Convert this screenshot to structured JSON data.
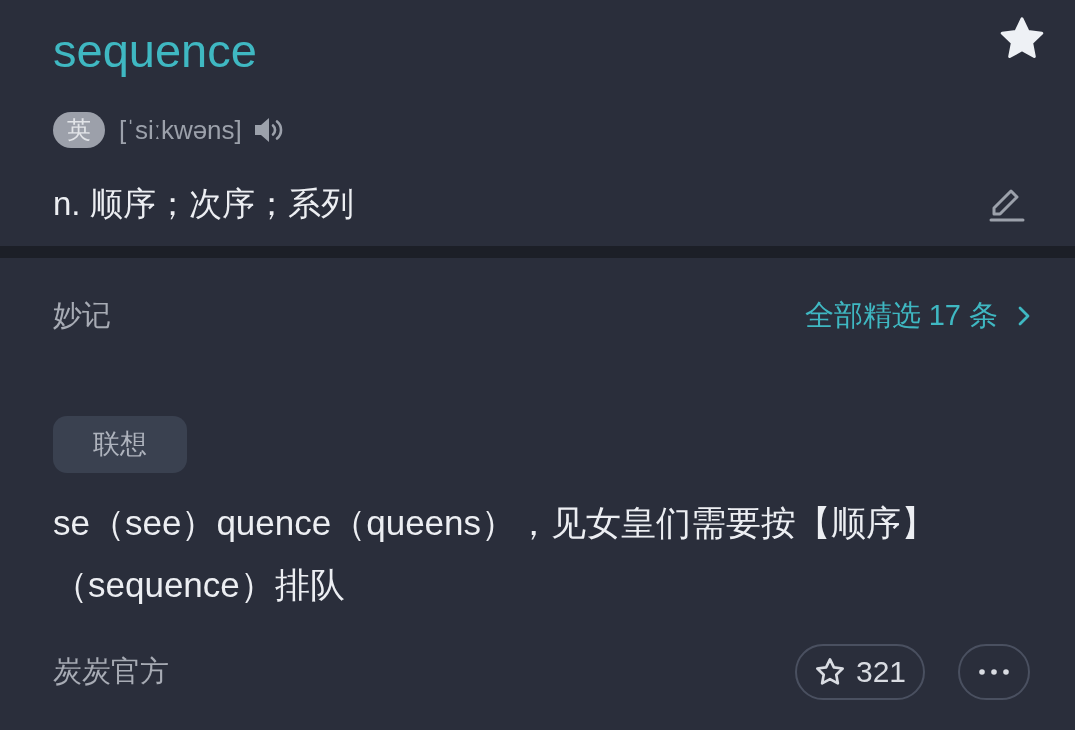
{
  "entry": {
    "word": "sequence",
    "starred": true,
    "pronunciation": {
      "accent": "英",
      "phonetic": "[ˈsiːkwəns]"
    },
    "definition": "n. 顺序；次序；系列"
  },
  "notes": {
    "title": "妙记",
    "all_link": "全部精选 17 条",
    "note": {
      "tag": "联想",
      "text": "se（see）quence（queens），见女皇们需要按【顺序】（sequence）排队",
      "author": "炭炭官方",
      "likes": "321",
      "liked": false
    }
  }
}
